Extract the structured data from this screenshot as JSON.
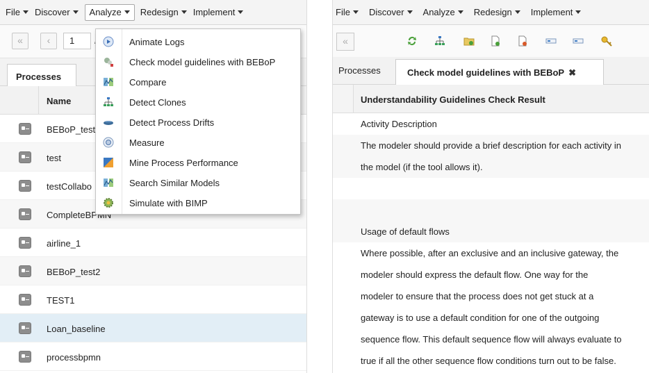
{
  "left": {
    "menu": [
      {
        "label": "File"
      },
      {
        "label": "Discover"
      },
      {
        "label": "Analyze"
      },
      {
        "label": "Redesign"
      },
      {
        "label": "Implement"
      }
    ],
    "pagination": {
      "first": "«",
      "prev": "‹",
      "page": "1",
      "sep": "/"
    },
    "tab_label": "Processes",
    "column_name": "Name",
    "rows": [
      {
        "name": "BEBoP_test"
      },
      {
        "name": "test"
      },
      {
        "name": "testCollabo"
      },
      {
        "name": "CompleteBPMN"
      },
      {
        "name": "airline_1"
      },
      {
        "name": "BEBoP_test2"
      },
      {
        "name": "TEST1"
      },
      {
        "name": "Loan_baseline"
      },
      {
        "name": "processbpmn"
      }
    ],
    "dropdown": [
      {
        "label": "Animate Logs",
        "icon": "play-circle-icon"
      },
      {
        "label": "Check model guidelines with BEBoP",
        "icon": "bebop-icon"
      },
      {
        "label": "Compare",
        "icon": "compare-chart-icon"
      },
      {
        "label": "Detect Clones",
        "icon": "hierarchy-icon"
      },
      {
        "label": "Detect Process Drifts",
        "icon": "drift-icon"
      },
      {
        "label": "Measure",
        "icon": "gauge-icon"
      },
      {
        "label": "Mine Process Performance",
        "icon": "performance-icon"
      },
      {
        "label": "Search Similar Models",
        "icon": "compare-chart-icon"
      },
      {
        "label": "Simulate with BIMP",
        "icon": "gear-sim-icon"
      }
    ]
  },
  "right": {
    "menu": [
      {
        "label": "File"
      },
      {
        "label": "Discover"
      },
      {
        "label": "Analyze"
      },
      {
        "label": "Redesign"
      },
      {
        "label": "Implement"
      }
    ],
    "first_label": "«",
    "tab_processes": "Processes",
    "tab_active": "Check model guidelines with BEBoP",
    "tab_close": "✖",
    "result_header": "Understandability Guidelines Check Result",
    "lines": [
      {
        "text": "Activity Description",
        "alt": false
      },
      {
        "text": "The modeler should provide a brief description for each activity in",
        "alt": true
      },
      {
        "text": "the model (if the tool allows it).",
        "alt": true
      },
      {
        "text": "",
        "alt": false
      },
      {
        "text": "",
        "alt": true
      },
      {
        "text": "Usage of default flows",
        "alt": true
      },
      {
        "text": "Where possible, after an exclusive and an inclusive gateway, the",
        "alt": false
      },
      {
        "text": "modeler should express the default flow. One way for the",
        "alt": false
      },
      {
        "text": "modeler to ensure that the process does not get stuck at a",
        "alt": false
      },
      {
        "text": "gateway is to use a default condition for one of the outgoing",
        "alt": false
      },
      {
        "text": "sequence flow. This default sequence flow will always evaluate to",
        "alt": false
      },
      {
        "text": "true if all the other sequence flow conditions turn out to be false.",
        "alt": false
      }
    ]
  }
}
